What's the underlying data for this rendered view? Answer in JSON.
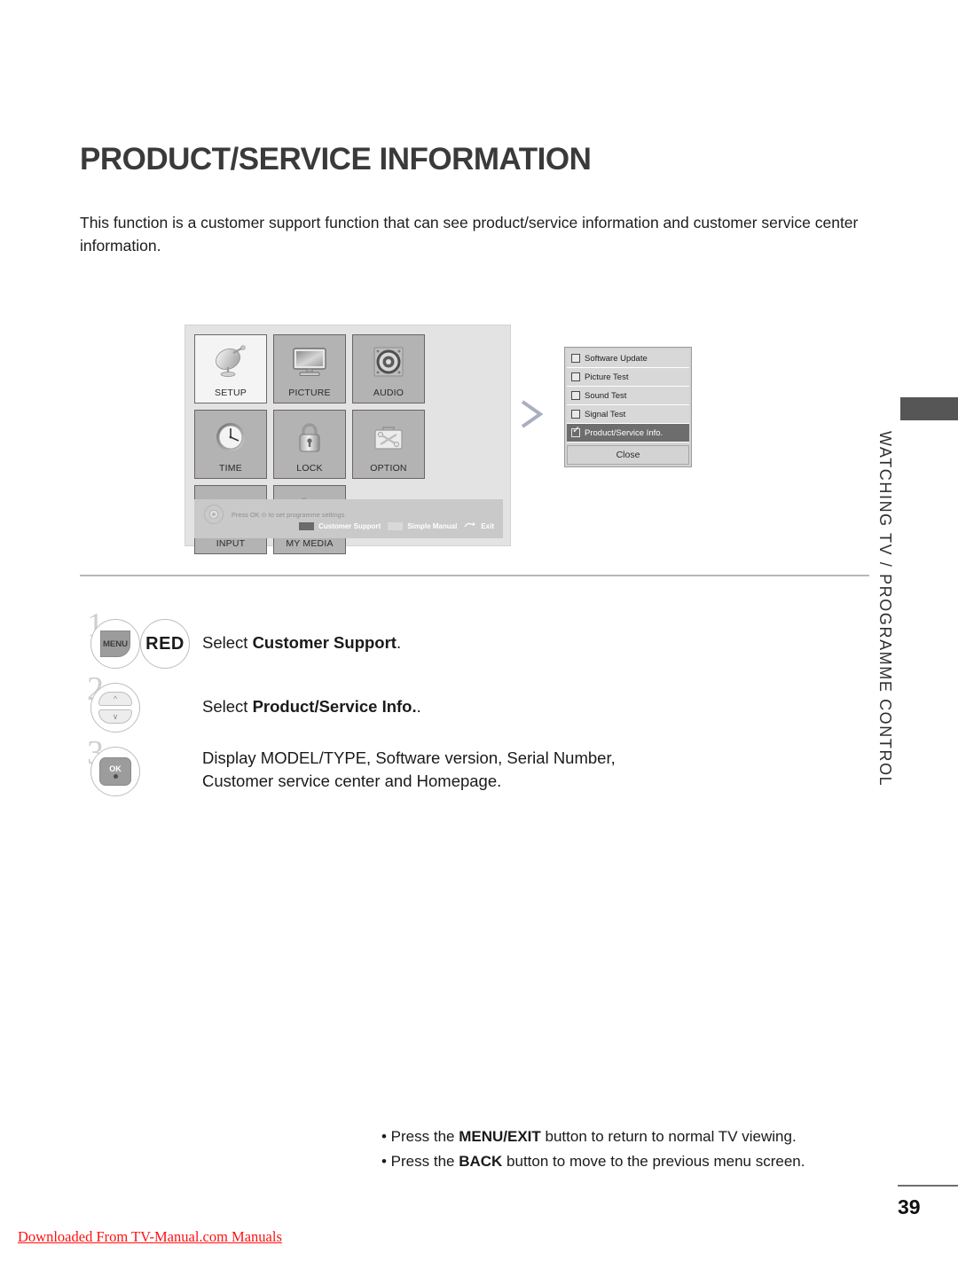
{
  "page": {
    "title": "PRODUCT/SERVICE INFORMATION",
    "intro": "This function is a customer support function that can see product/service information and customer service center information.",
    "number": "39",
    "side_tab_text": "WATCHING TV / PROGRAMME CONTROL",
    "watermark": "Downloaded From TV-Manual.com Manuals"
  },
  "osd": {
    "tiles": [
      {
        "label": "SETUP",
        "icon": "satellite-dish-icon",
        "selected": true
      },
      {
        "label": "PICTURE",
        "icon": "monitor-icon",
        "selected": false
      },
      {
        "label": "AUDIO",
        "icon": "speaker-icon",
        "selected": false
      },
      {
        "label": "TIME",
        "icon": "clock-icon",
        "selected": false
      },
      {
        "label": "LOCK",
        "icon": "padlock-icon",
        "selected": false
      },
      {
        "label": "OPTION",
        "icon": "toolbox-icon",
        "selected": false
      },
      {
        "label": "INPUT",
        "icon": "plug-cable-icon",
        "selected": false
      },
      {
        "label": "MY MEDIA",
        "icon": "media-collage-icon",
        "selected": false
      }
    ],
    "hint": "Press OK ⊙ to set programme settings.",
    "keys": [
      {
        "label": "Customer Support",
        "color": "#6b6b6b"
      },
      {
        "label": "Simple Manual",
        "color": "#d9d9d9"
      },
      {
        "label": "Exit",
        "color": ""
      }
    ]
  },
  "submenu": {
    "items": [
      {
        "label": "Software Update",
        "checked": false
      },
      {
        "label": "Picture Test",
        "checked": false
      },
      {
        "label": "Sound Test",
        "checked": false
      },
      {
        "label": "Signal Test",
        "checked": false
      },
      {
        "label": "Product/Service Info.",
        "checked": true
      }
    ],
    "close_label": "Close"
  },
  "steps": [
    {
      "number": "1",
      "button_primary": "MENU",
      "button_secondary": "RED",
      "text_prefix": "Select ",
      "text_bold": "Customer Support",
      "text_suffix": "."
    },
    {
      "number": "2",
      "button_primary": "CH",
      "text_prefix": "Select ",
      "text_bold": "Product/Service Info.",
      "text_suffix": "."
    },
    {
      "number": "3",
      "button_primary": "OK",
      "line1": "Display MODEL/TYPE, Software version, Serial Number,",
      "line2": "Customer service center and Homepage."
    }
  ],
  "notes": [
    {
      "prefix": "• Press the ",
      "bold": "MENU/EXIT",
      "suffix": " button to return to normal TV viewing."
    },
    {
      "prefix": "• Press the ",
      "bold": "BACK",
      "suffix": " button to move to the previous menu screen."
    }
  ]
}
